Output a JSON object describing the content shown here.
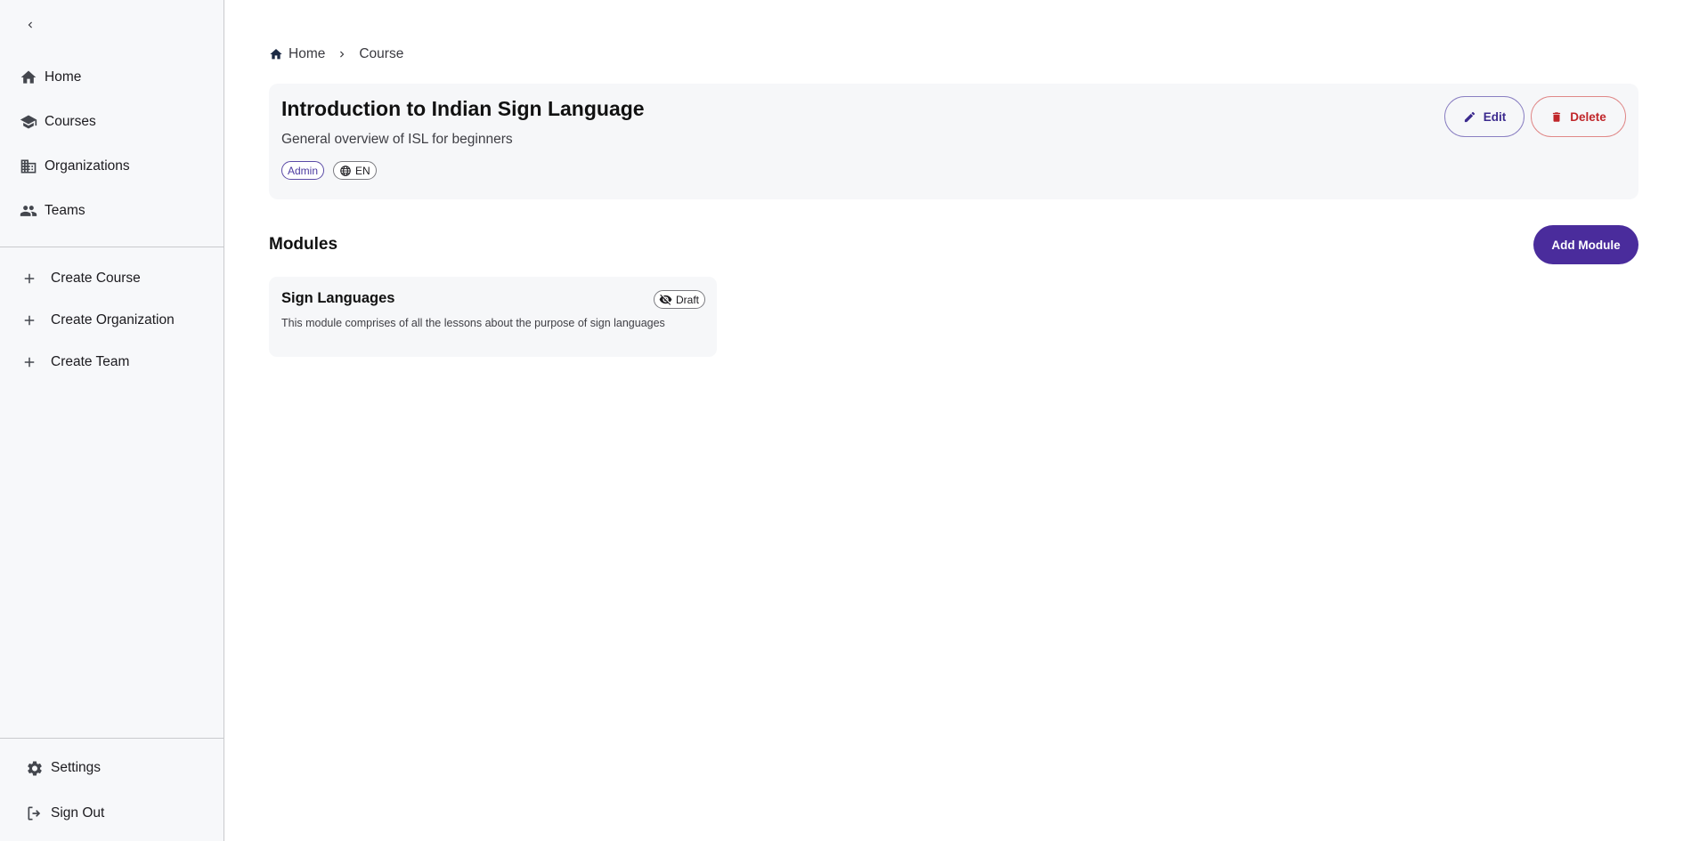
{
  "sidebar": {
    "collapse_icon": "chevron-left-icon",
    "nav": [
      {
        "label": "Home",
        "icon": "home-icon"
      },
      {
        "label": "Courses",
        "icon": "school-icon"
      },
      {
        "label": "Organizations",
        "icon": "building-icon"
      },
      {
        "label": "Teams",
        "icon": "people-icon"
      }
    ],
    "create": [
      {
        "label": "Create Course",
        "icon": "plus-icon"
      },
      {
        "label": "Create Organization",
        "icon": "plus-icon"
      },
      {
        "label": "Create Team",
        "icon": "plus-icon"
      }
    ],
    "bottom": [
      {
        "label": "Settings",
        "icon": "gear-icon"
      },
      {
        "label": "Sign Out",
        "icon": "logout-icon"
      }
    ]
  },
  "breadcrumb": {
    "home": "Home",
    "current": "Course"
  },
  "course": {
    "title": "Introduction to Indian Sign Language",
    "description": "General overview of ISL for beginners",
    "role_badge": "Admin",
    "language_badge": "EN",
    "edit_label": "Edit",
    "delete_label": "Delete"
  },
  "modules": {
    "heading": "Modules",
    "add_label": "Add Module",
    "items": [
      {
        "title": "Sign Languages",
        "status": "Draft",
        "description": "This module comprises of all the lessons about the purpose of sign languages"
      }
    ]
  },
  "colors": {
    "primary": "#4a2c9c",
    "danger": "#c0262a",
    "sidebar_bg": "#f7f8fa",
    "card_bg": "#f6f7f9"
  }
}
